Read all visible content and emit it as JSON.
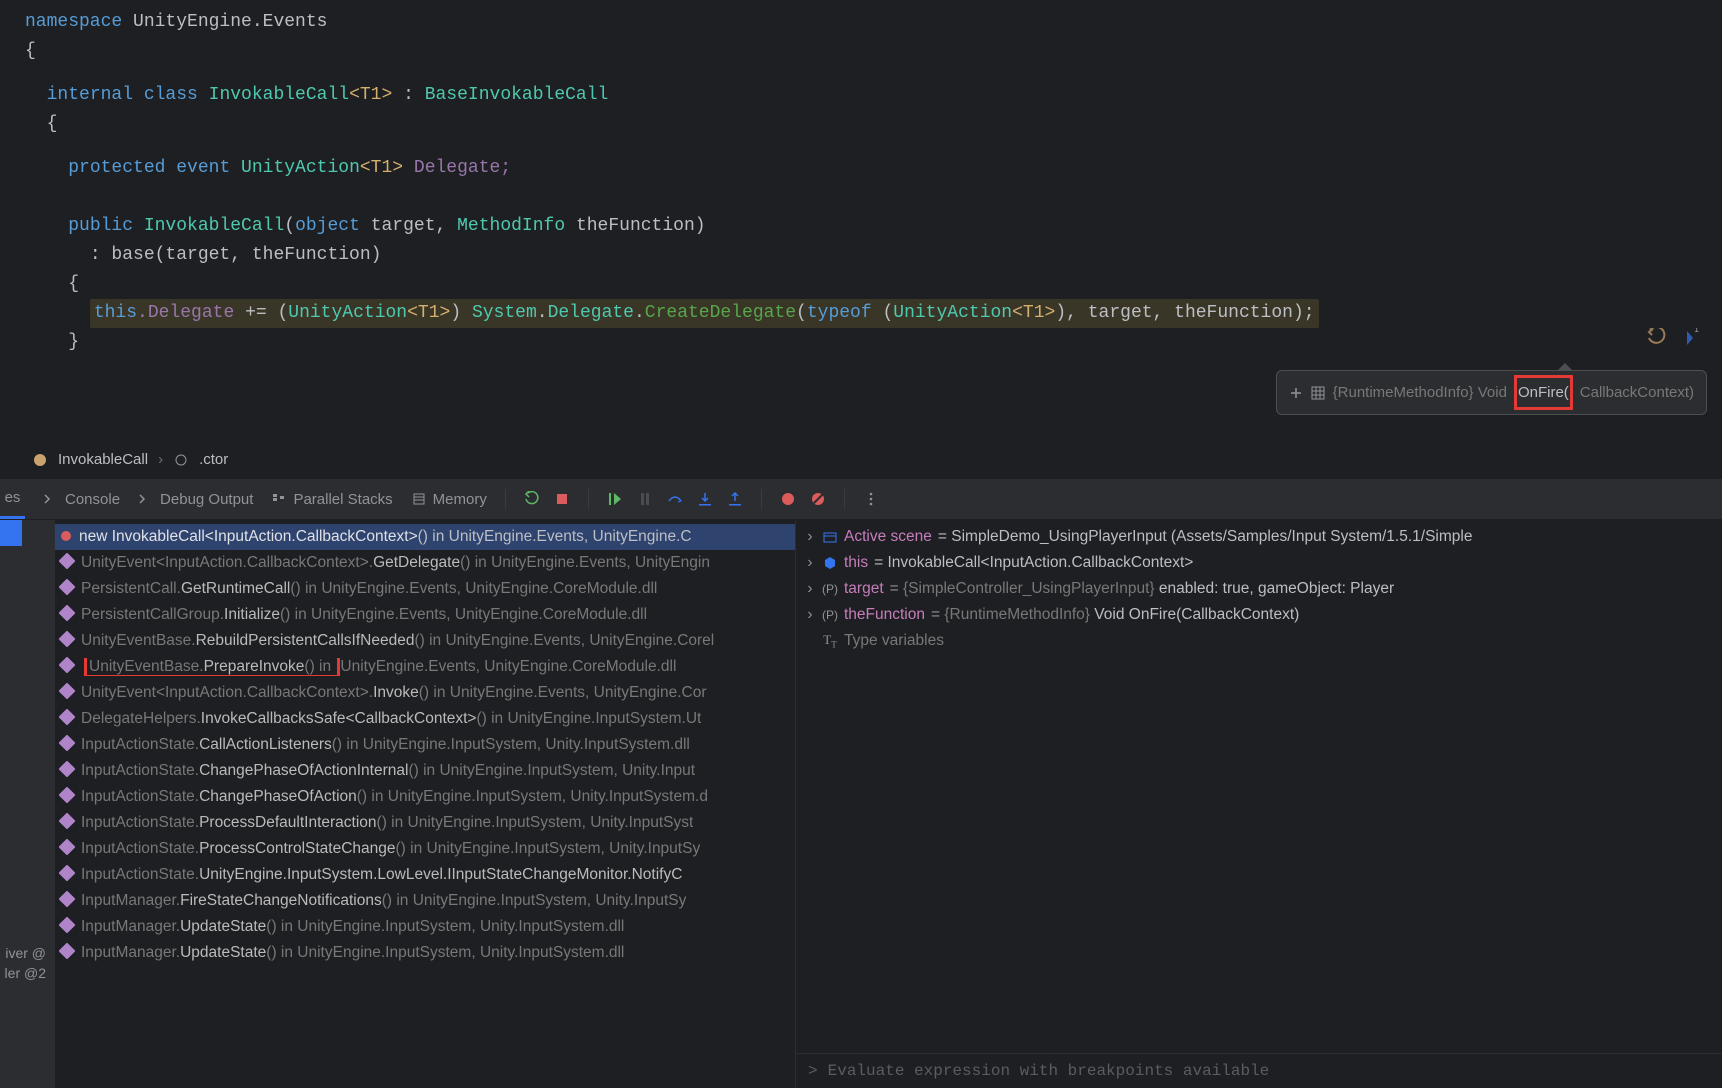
{
  "code": {
    "line1_kw": "namespace",
    "line1_ns": " UnityEngine.Events",
    "line2": "{",
    "line3_kw": "internal class",
    "line3_cls": " InvokableCall",
    "line3_gen": "<T1>",
    "line3_sep": " : ",
    "line3_base": "BaseInvokableCall",
    "line4": "{",
    "line5_kw": "protected event",
    "line5_type": " UnityAction",
    "line5_gen": "<T1>",
    "line5_name": " Delegate;",
    "line6_kw": "public",
    "line6_ctor": " InvokableCall",
    "line6_params": "(object target, MethodInfo theFunction)",
    "line6_p_obj": "object",
    "line6_p_tgt": " target, ",
    "line6_p_mi": "MethodInfo",
    "line6_p_fn": " theFunction)",
    "line7": ": base(target, theFunction)",
    "line8": "{",
    "line9_this": "this",
    "line9_del": ".Delegate ",
    "line9_op": "+= ",
    "line9_cast1": "(UnityAction",
    "line9_cast2": "<T1>) ",
    "line9_sys": "System.Delegate.",
    "line9_create": "CreateDelegate",
    "line9_typeof": "(typeof ",
    "line9_ua": "(UnityAction",
    "line9_t1": "<T1>",
    "line9_rest": "), target, theFunction);",
    "line10": "}"
  },
  "tooltip": {
    "prefix": "{RuntimeMethodInfo} Void ",
    "highlighted": "OnFire(",
    "suffix": "CallbackContext)"
  },
  "breadcrumb": {
    "item1": "InvokableCall",
    "item2": ".ctor"
  },
  "toolbar": {
    "tab_trunc": "es",
    "console": "Console",
    "debug_output": "Debug Output",
    "parallel_stacks": "Parallel Stacks",
    "memory": "Memory"
  },
  "stack": [
    {
      "icon": "dot",
      "bright": "new InvokableCall<InputAction.CallbackContext>",
      "dim": "() in UnityEngine.Events, UnityEngine.C",
      "sel": true
    },
    {
      "icon": "diamond",
      "bright": "",
      "pre": "UnityEvent<InputAction.CallbackContext>.",
      "b2": "GetDelegate",
      "dim": "() in UnityEngine.Events, UnityEngin"
    },
    {
      "icon": "diamond",
      "pre": "PersistentCall.",
      "b2": "GetRuntimeCall",
      "dim": "() in UnityEngine.Events, UnityEngine.CoreModule.dll"
    },
    {
      "icon": "diamond",
      "pre": "PersistentCallGroup.",
      "b2": "Initialize",
      "dim": "() in UnityEngine.Events, UnityEngine.CoreModule.dll"
    },
    {
      "icon": "diamond",
      "pre": "UnityEventBase.",
      "b2": "RebuildPersistentCallsIfNeeded",
      "dim": "() in UnityEngine.Events, UnityEngine.Corel"
    },
    {
      "icon": "diamond",
      "pre": "UnityEventBase.",
      "b2": "PrepareInvoke",
      "dim": "() in ",
      "dim2": "UnityEngine.Events, UnityEngine.CoreModule.dll",
      "boxed": true
    },
    {
      "icon": "diamond",
      "pre": "UnityEvent<InputAction.CallbackContext>.",
      "b2": "Invoke",
      "dim": "() in UnityEngine.Events, UnityEngine.Cor"
    },
    {
      "icon": "diamond",
      "pre": "DelegateHelpers.",
      "b2": "InvokeCallbacksSafe<CallbackContext>",
      "dim": "() in UnityEngine.InputSystem.Ut"
    },
    {
      "icon": "diamond",
      "pre": "InputActionState.",
      "b2": "CallActionListeners",
      "dim": "() in UnityEngine.InputSystem, Unity.InputSystem.dll"
    },
    {
      "icon": "diamond",
      "pre": "InputActionState.",
      "b2": "ChangePhaseOfActionInternal",
      "dim": "() in UnityEngine.InputSystem, Unity.Input"
    },
    {
      "icon": "diamond",
      "pre": "InputActionState.",
      "b2": "ChangePhaseOfAction",
      "dim": "() in UnityEngine.InputSystem, Unity.InputSystem.d"
    },
    {
      "icon": "diamond",
      "pre": "InputActionState.",
      "b2": "ProcessDefaultInteraction",
      "dim": "() in UnityEngine.InputSystem, Unity.InputSyst"
    },
    {
      "icon": "diamond",
      "pre": "InputActionState.",
      "b2": "ProcessControlStateChange",
      "dim": "() in UnityEngine.InputSystem, Unity.InputSy"
    },
    {
      "icon": "diamond",
      "pre": "InputActionState.",
      "b2": "UnityEngine.InputSystem.LowLevel.IInputStateChangeMonitor.NotifyC",
      "dim": ""
    },
    {
      "icon": "diamond",
      "pre": "InputManager.",
      "b2": "FireStateChangeNotifications",
      "dim": "() in UnityEngine.InputSystem, Unity.InputSy"
    },
    {
      "icon": "diamond",
      "pre": "InputManager.",
      "b2": "UpdateState",
      "dim": "() in UnityEngine.InputSystem, Unity.InputSystem.dll"
    },
    {
      "icon": "diamond",
      "pre": "InputManager.",
      "b2": "UpdateState",
      "dim": "() in UnityEngine.InputSystem, Unity.InputSystem.dll"
    }
  ],
  "gutter": {
    "text1": "iver @",
    "text2": "ler @2"
  },
  "vars": [
    {
      "icon": "scene",
      "name": "Active scene",
      "val": "= SimpleDemo_UsingPlayerInput (Assets/Samples/Input System/1.5.1/Simple",
      "dim": false
    },
    {
      "icon": "cube",
      "name": "this",
      "val": "= InvokableCall<InputAction.CallbackContext>",
      "dim": false
    },
    {
      "icon": "param",
      "name": "target",
      "val": "= ",
      "v2": "{SimpleController_UsingPlayerInput}",
      "v3": " enabled: true, gameObject: Player",
      "dim": false
    },
    {
      "icon": "param",
      "name": "theFunction",
      "val": "= ",
      "v2": "{RuntimeMethodInfo}",
      "v3": " Void OnFire(CallbackContext)",
      "dim": false
    },
    {
      "icon": "type",
      "name": "Type variables",
      "val": "",
      "dim": true,
      "noexpand": true
    }
  ],
  "eval": {
    "prompt": ">",
    "placeholder": "Evaluate expression with breakpoints available"
  }
}
